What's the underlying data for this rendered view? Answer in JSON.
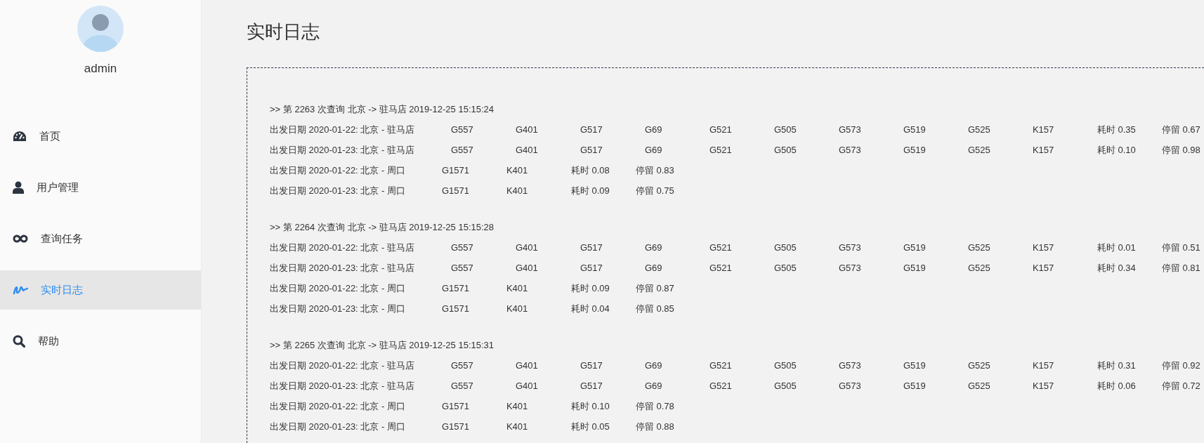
{
  "user": {
    "name": "admin"
  },
  "nav": [
    {
      "label": "首页",
      "kind": "gauge",
      "selected": false
    },
    {
      "label": "用户管理",
      "kind": "user",
      "selected": false
    },
    {
      "label": "查询任务",
      "kind": "infinity",
      "selected": false
    },
    {
      "label": "实时日志",
      "kind": "wave",
      "selected": true
    },
    {
      "label": "帮助",
      "kind": "search",
      "selected": false
    }
  ],
  "page": {
    "title": "实时日志"
  },
  "logs": [
    {
      "header": ">> 第 2263 次查询 北京 -> 驻马店 2019-12-25 15:15:24",
      "rows": [
        {
          "label": "出发日期 2020-01-22: 北京 - 驻马店",
          "trains": [
            "G557",
            "G401",
            "G517",
            "G69",
            "G521",
            "G505",
            "G573",
            "G519",
            "G525",
            "K157"
          ],
          "cost": "耗时 0.35",
          "stay": "停留 0.67"
        },
        {
          "label": "出发日期 2020-01-23: 北京 - 驻马店",
          "trains": [
            "G557",
            "G401",
            "G517",
            "G69",
            "G521",
            "G505",
            "G573",
            "G519",
            "G525",
            "K157"
          ],
          "cost": "耗时 0.10",
          "stay": "停留 0.98"
        },
        {
          "label": "出发日期 2020-01-22: 北京 - 周口",
          "trains": [
            "G1571",
            "K401"
          ],
          "cost": "耗时 0.08",
          "stay": "停留 0.83"
        },
        {
          "label": "出发日期 2020-01-23: 北京 - 周口",
          "trains": [
            "G1571",
            "K401"
          ],
          "cost": "耗时 0.09",
          "stay": "停留 0.75"
        }
      ]
    },
    {
      "header": ">> 第 2264 次查询 北京 -> 驻马店 2019-12-25 15:15:28",
      "rows": [
        {
          "label": "出发日期 2020-01-22: 北京 - 驻马店",
          "trains": [
            "G557",
            "G401",
            "G517",
            "G69",
            "G521",
            "G505",
            "G573",
            "G519",
            "G525",
            "K157"
          ],
          "cost": "耗时 0.01",
          "stay": "停留 0.51"
        },
        {
          "label": "出发日期 2020-01-23: 北京 - 驻马店",
          "trains": [
            "G557",
            "G401",
            "G517",
            "G69",
            "G521",
            "G505",
            "G573",
            "G519",
            "G525",
            "K157"
          ],
          "cost": "耗时 0.34",
          "stay": "停留 0.81"
        },
        {
          "label": "出发日期 2020-01-22: 北京 - 周口",
          "trains": [
            "G1571",
            "K401"
          ],
          "cost": "耗时 0.09",
          "stay": "停留 0.87"
        },
        {
          "label": "出发日期 2020-01-23: 北京 - 周口",
          "trains": [
            "G1571",
            "K401"
          ],
          "cost": "耗时 0.04",
          "stay": "停留 0.85"
        }
      ]
    },
    {
      "header": ">> 第 2265 次查询 北京 -> 驻马店 2019-12-25 15:15:31",
      "rows": [
        {
          "label": "出发日期 2020-01-22: 北京 - 驻马店",
          "trains": [
            "G557",
            "G401",
            "G517",
            "G69",
            "G521",
            "G505",
            "G573",
            "G519",
            "G525",
            "K157"
          ],
          "cost": "耗时 0.31",
          "stay": "停留 0.92"
        },
        {
          "label": "出发日期 2020-01-23: 北京 - 驻马店",
          "trains": [
            "G557",
            "G401",
            "G517",
            "G69",
            "G521",
            "G505",
            "G573",
            "G519",
            "G525",
            "K157"
          ],
          "cost": "耗时 0.06",
          "stay": "停留 0.72"
        },
        {
          "label": "出发日期 2020-01-22: 北京 - 周口",
          "trains": [
            "G1571",
            "K401"
          ],
          "cost": "耗时 0.10",
          "stay": "停留 0.78"
        },
        {
          "label": "出发日期 2020-01-23: 北京 - 周口",
          "trains": [
            "G1571",
            "K401"
          ],
          "cost": "耗时 0.05",
          "stay": "停留 0.88"
        }
      ]
    }
  ]
}
